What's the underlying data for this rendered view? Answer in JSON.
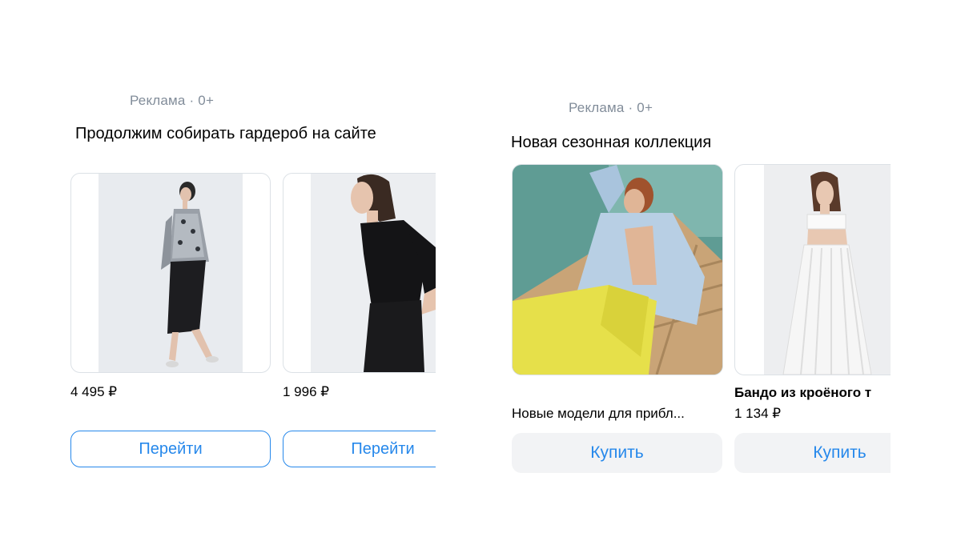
{
  "ads": [
    {
      "meta": "Реклама · 0+",
      "title": "Продолжим собирать гардероб на сайте",
      "cards": [
        {
          "price": "4 495 ₽",
          "button": "Перейти"
        },
        {
          "price": "1 996 ₽",
          "button": "Перейти"
        }
      ]
    },
    {
      "meta": "Реклама · 0+",
      "title": "Новая сезонная коллекция",
      "cards": [
        {
          "description": "Новые модели для прибл...",
          "button": "Купить"
        },
        {
          "name": "Бандо из кроёного т",
          "price": "1 134 ₽",
          "button": "Купить"
        }
      ]
    }
  ],
  "colors": {
    "accent": "#2688eb",
    "meta_text": "#818c99",
    "card_border": "#dce1e6",
    "button_fill": "#f2f3f5"
  }
}
